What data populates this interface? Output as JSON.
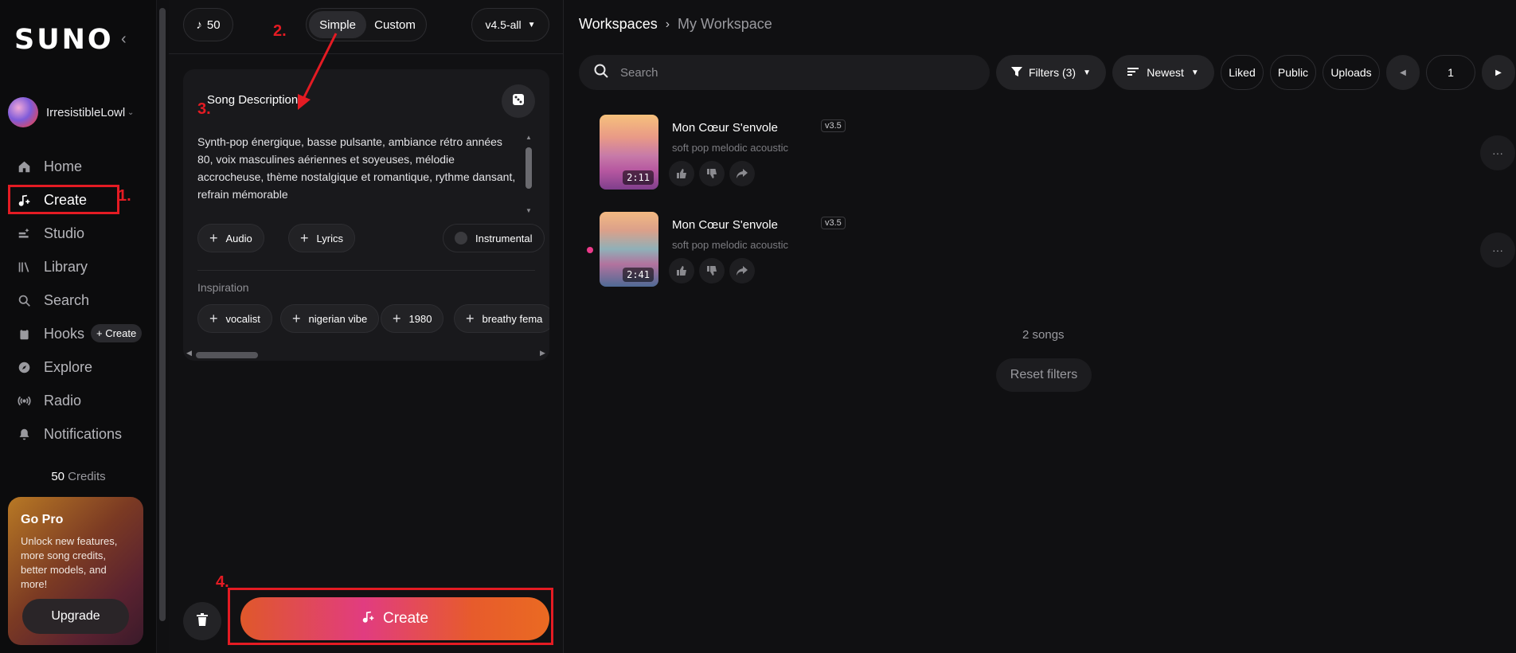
{
  "sidebar": {
    "logo": "SUNO",
    "username": "IrresistibleLowl",
    "nav": [
      {
        "label": "Home",
        "icon": "home-icon"
      },
      {
        "label": "Create",
        "icon": "create-icon"
      },
      {
        "label": "Studio",
        "icon": "studio-icon"
      },
      {
        "label": "Library",
        "icon": "library-icon"
      },
      {
        "label": "Search",
        "icon": "search-icon"
      },
      {
        "label": "Hooks",
        "icon": "hooks-icon"
      },
      {
        "label": "Explore",
        "icon": "explore-icon"
      },
      {
        "label": "Radio",
        "icon": "radio-icon"
      },
      {
        "label": "Notifications",
        "icon": "bell-icon"
      }
    ],
    "hooks_create": "+ Create",
    "credits_value": "50",
    "credits_label": "Credits",
    "gopro": {
      "title": "Go Pro",
      "text": "Unlock new features, more song credits, better models, and more!",
      "button": "Upgrade"
    }
  },
  "creator": {
    "credits": "50",
    "mode_simple": "Simple",
    "mode_custom": "Custom",
    "model": "v4.5-all",
    "card_title": "Song Description",
    "description": "Synth-pop énergique, basse pulsante, ambiance rétro années 80, voix masculines aériennes et soyeuses, mélodie accrocheuse, thème nostalgique et romantique, rythme dansant, refrain mémorable",
    "audio_label": "Audio",
    "lyrics_label": "Lyrics",
    "instrumental_label": "Instrumental",
    "inspiration_label": "Inspiration",
    "inspiration_chips": [
      "vocalist",
      "nigerian vibe",
      "1980",
      "breathy fema"
    ],
    "create_label": "Create"
  },
  "workspace": {
    "breadcrumb_root": "Workspaces",
    "breadcrumb_current": "My Workspace",
    "search_placeholder": "Search",
    "filters_label": "Filters (3)",
    "sort_label": "Newest",
    "liked_label": "Liked",
    "public_label": "Public",
    "uploads_label": "Uploads",
    "page": "1",
    "songs": [
      {
        "title": "Mon Cœur S'envole",
        "version": "v3.5",
        "genre": "soft pop melodic acoustic",
        "duration": "2:11"
      },
      {
        "title": "Mon Cœur S'envole",
        "version": "v3.5",
        "genre": "soft pop melodic acoustic",
        "duration": "2:41"
      }
    ],
    "song_count": "2 songs",
    "reset_label": "Reset filters"
  },
  "annotations": {
    "step1": "1.",
    "step2": "2.",
    "step3": "3.",
    "step4": "4."
  },
  "colors": {
    "annotation_red": "#e41b23",
    "accent_pink": "#ec3a8a",
    "background": "#101012"
  }
}
